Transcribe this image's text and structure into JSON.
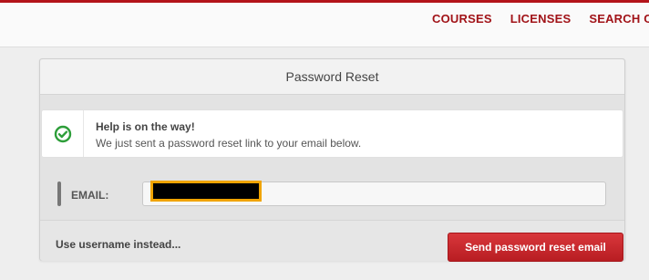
{
  "nav": {
    "items": [
      {
        "label": "COURSES"
      },
      {
        "label": "LICENSES"
      },
      {
        "label": "SEARCH COU"
      }
    ]
  },
  "panel": {
    "title": "Password Reset"
  },
  "alert": {
    "icon": "check-circle-icon",
    "title": "Help is on the way!",
    "message": "We just sent a password reset link to your email below."
  },
  "form": {
    "email_label": "EMAIL:",
    "email_value": ""
  },
  "footer": {
    "alt_link": "Use username instead...",
    "submit_label": "Send password reset email"
  },
  "colors": {
    "accent": "#b3141a",
    "button": "#c8272c",
    "success": "#2e9e3a"
  }
}
